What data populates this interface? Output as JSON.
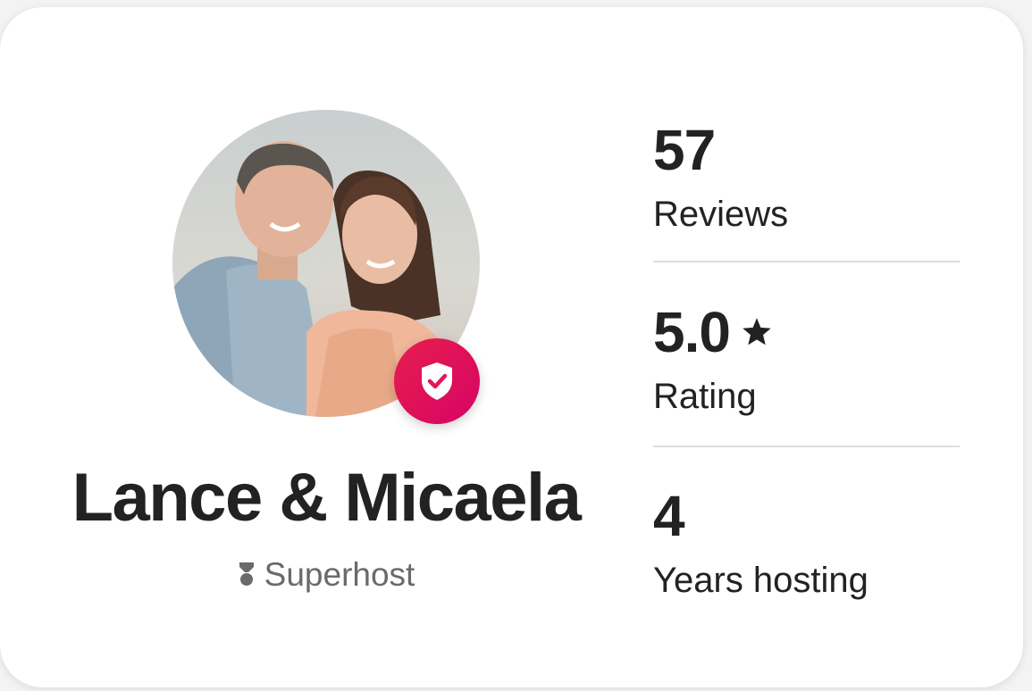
{
  "host": {
    "name": "Lance & Micaela",
    "badge_label": "Superhost",
    "avatar_alt": "",
    "verified_icon": "shield-check-icon",
    "superhost_icon": "superhost-icon"
  },
  "stats": [
    {
      "value": "57",
      "label": "Reviews"
    },
    {
      "value": "5.0",
      "label": "Rating",
      "icon": "star-icon"
    },
    {
      "value": "4",
      "label": "Years hosting"
    }
  ],
  "colors": {
    "text": "#222222",
    "muted": "#6a6a6a",
    "brand": "#e61e4d",
    "divider": "#dddddd"
  }
}
